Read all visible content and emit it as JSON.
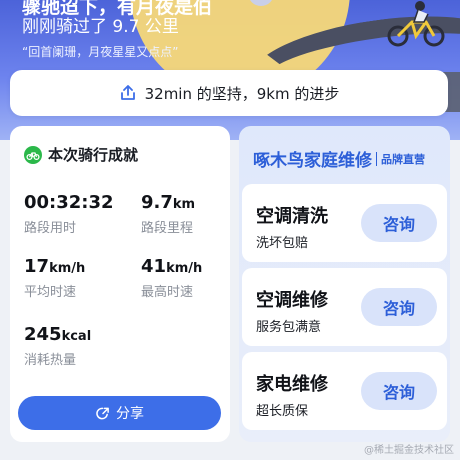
{
  "hero": {
    "title": "骤驰迢下，有月夜是伯",
    "subtitle": "刚刚骑过了 9.7 公里",
    "quote": "“回首阑珊，月夜星星又点点”"
  },
  "progress": {
    "text": "32min 的坚持，9km 的进步",
    "icon": "share-up-icon"
  },
  "ride": {
    "section_label": "本次骑行成就",
    "stats": [
      {
        "value": "00:32:32",
        "unit": "",
        "label": "路段用时"
      },
      {
        "value": "9.7",
        "unit": "km",
        "label": "路段里程"
      },
      {
        "value": "17",
        "unit": "km/h",
        "label": "平均时速"
      },
      {
        "value": "41",
        "unit": "km/h",
        "label": "最高时速"
      },
      {
        "value": "245",
        "unit": "kcal",
        "label": "消耗热量"
      }
    ],
    "share_label": "分享"
  },
  "ad": {
    "title": "啄木鸟家庭维修",
    "tag": "品牌直营",
    "services": [
      {
        "name": "空调清洗",
        "desc": "洗坏包赔",
        "button": "咨询"
      },
      {
        "name": "空调维修",
        "desc": "服务包满意",
        "button": "咨询"
      },
      {
        "name": "家电维修",
        "desc": "超长质保",
        "button": "咨询"
      }
    ]
  },
  "watermark": "@稀土掘金技术社区",
  "colors": {
    "accent": "#3d6ee8",
    "brand_blue": "#2d5fd8",
    "achievement_green": "#2bb84a"
  }
}
